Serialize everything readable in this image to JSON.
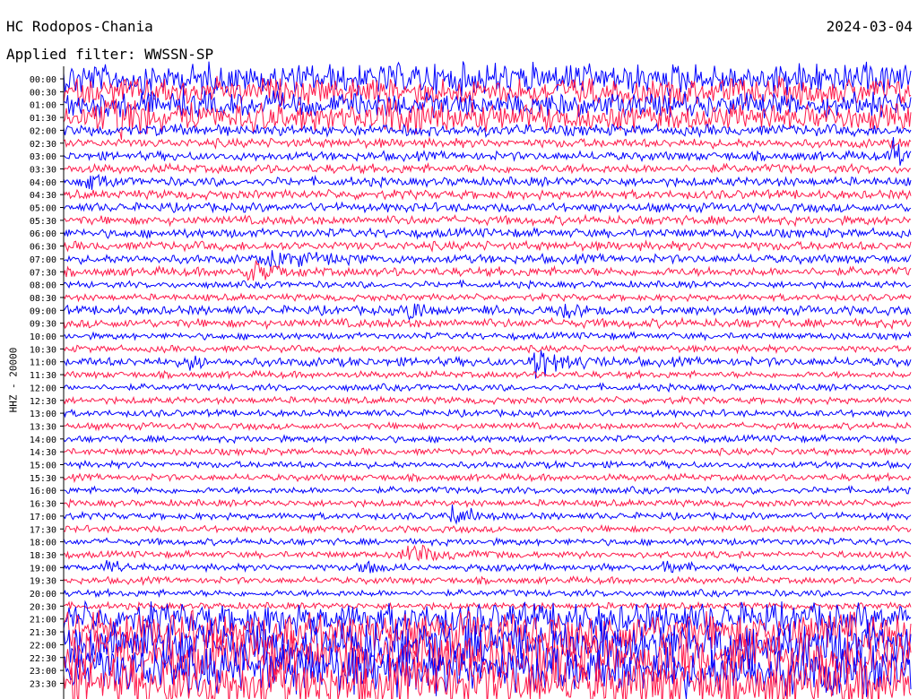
{
  "header": {
    "station": "HC Rodopos-Chania",
    "date": "2024-03-04",
    "filter_label": "Applied filter: WWSSN-SP",
    "channel_label": "HHZ - 20000"
  },
  "colors": {
    "trace_a": "#0000ff",
    "trace_b": "#ff1a4b",
    "axis": "#000000"
  },
  "chart_data": {
    "type": "line",
    "title": "HC Rodopos-Chania",
    "date": "2024-03-04",
    "ylabel": "HHZ - 20000",
    "grid": false,
    "ytick_labels": [
      "00:00",
      "00:30",
      "01:00",
      "01:30",
      "02:00",
      "02:30",
      "03:00",
      "03:30",
      "04:00",
      "04:30",
      "05:00",
      "05:30",
      "06:00",
      "06:30",
      "07:00",
      "07:30",
      "08:00",
      "08:30",
      "09:00",
      "09:30",
      "10:00",
      "10:30",
      "11:00",
      "11:30",
      "12:00",
      "12:30",
      "13:00",
      "13:30",
      "14:00",
      "14:30",
      "15:00",
      "15:30",
      "16:00",
      "16:30",
      "17:00",
      "17:30",
      "18:00",
      "18:30",
      "19:00",
      "19:30",
      "20:00",
      "20:30",
      "21:00",
      "21:30",
      "22:00",
      "22:30",
      "23:00",
      "23:30"
    ],
    "x_range_minutes": [
      0,
      30
    ],
    "noise_level": [
      14,
      12,
      11,
      12,
      5,
      4,
      4,
      4,
      4,
      4,
      4,
      4,
      4,
      4,
      4,
      4,
      3,
      3,
      4,
      4,
      3,
      3,
      4,
      3,
      3,
      3,
      3,
      3,
      3,
      3,
      3,
      3,
      3,
      3,
      3,
      3,
      3,
      3,
      3,
      3,
      3,
      3,
      14,
      18,
      22,
      22,
      22,
      22
    ],
    "events": [
      {
        "row": 3,
        "x": 0.38,
        "amp": 18,
        "dur": 0.05
      },
      {
        "row": 3,
        "x": 0.05,
        "amp": 10,
        "dur": 0.1
      },
      {
        "row": 6,
        "x": 0.98,
        "amp": 16,
        "dur": 0.02
      },
      {
        "row": 8,
        "x": 0.03,
        "amp": 7,
        "dur": 0.03
      },
      {
        "row": 14,
        "x": 0.25,
        "amp": 8,
        "dur": 0.08
      },
      {
        "row": 15,
        "x": 0.22,
        "amp": 9,
        "dur": 0.06
      },
      {
        "row": 18,
        "x": 0.41,
        "amp": 8,
        "dur": 0.04
      },
      {
        "row": 18,
        "x": 0.59,
        "amp": 8,
        "dur": 0.03
      },
      {
        "row": 22,
        "x": 0.56,
        "amp": 16,
        "dur": 0.06
      },
      {
        "row": 22,
        "x": 0.15,
        "amp": 7,
        "dur": 0.02
      },
      {
        "row": 34,
        "x": 0.46,
        "amp": 10,
        "dur": 0.05
      },
      {
        "row": 37,
        "x": 0.41,
        "amp": 9,
        "dur": 0.07
      },
      {
        "row": 38,
        "x": 0.05,
        "amp": 7,
        "dur": 0.05
      },
      {
        "row": 38,
        "x": 0.35,
        "amp": 7,
        "dur": 0.04
      },
      {
        "row": 38,
        "x": 0.71,
        "amp": 7,
        "dur": 0.04
      }
    ]
  }
}
